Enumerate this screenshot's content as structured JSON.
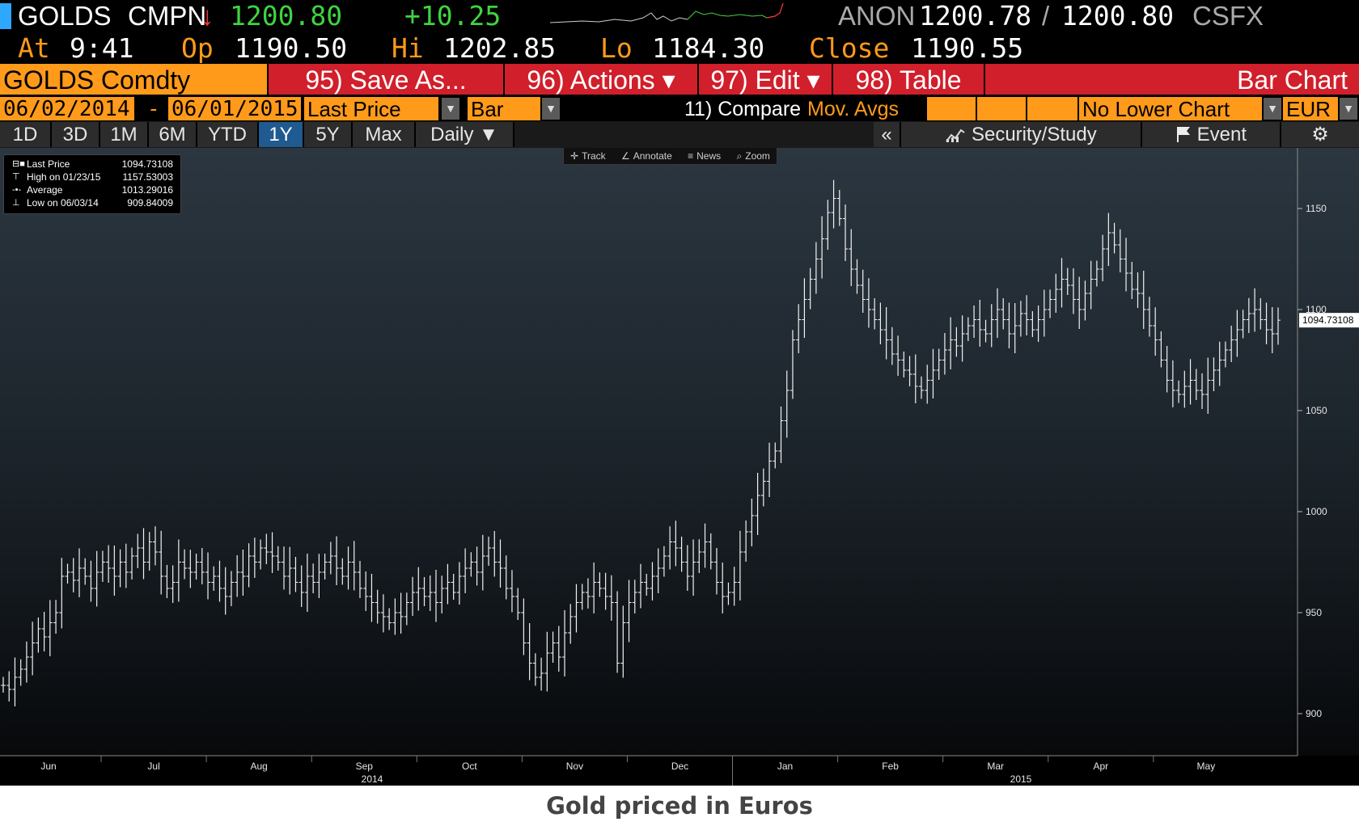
{
  "ticker": {
    "symbol": "GOLDS",
    "source": "CMPN",
    "arrow": "↓",
    "last": "1200.80",
    "change": "+10.25",
    "venue": "ANON",
    "bid": "1200.78",
    "slash": "/",
    "ask": "1200.80",
    "feed": "CSFX",
    "at_label": "At",
    "time": "9:41",
    "op_label": "Op",
    "open": "1190.50",
    "hi_label": "Hi",
    "high": "1202.85",
    "lo_label": "Lo",
    "low": "1184.30",
    "close_label": "Close",
    "close": "1190.55"
  },
  "menu": {
    "security": "GOLDS Comdty",
    "save_as": "95) Save As...",
    "actions": "96) Actions ▾",
    "edit": "97) Edit ▾",
    "table": "98) Table",
    "view": "Bar Chart"
  },
  "settings": {
    "start_date": "06/02/2014",
    "dash": "-",
    "end_date": "06/01/2015",
    "field": "Last Price",
    "style": "Bar",
    "compare": "11) Compare",
    "mov_avgs": "Mov. Avgs",
    "lower_chart": "No Lower Chart",
    "currency": "EUR",
    "dd_icon": "▼"
  },
  "ranges": [
    "1D",
    "3D",
    "1M",
    "6M",
    "YTD",
    "1Y",
    "5Y",
    "Max"
  ],
  "active_range": "1Y",
  "frequency": "Daily ▼",
  "tools": {
    "collapse": "«",
    "security_study": "Security/Study",
    "event": "Event",
    "gear": "⚙"
  },
  "chart_tools": {
    "track": "Track",
    "annotate": "Annotate",
    "news": "News",
    "zoom": "Zoom"
  },
  "legend": [
    {
      "label": "Last Price",
      "value": "1094.73108"
    },
    {
      "label": "High on 01/23/15",
      "value": "1157.53003"
    },
    {
      "label": "Average",
      "value": "1013.29016"
    },
    {
      "label": "Low on 06/03/14",
      "value": "909.84009"
    }
  ],
  "last_label": "1094.73108",
  "caption": "Gold priced in Euros",
  "colors": {
    "orange": "#ff9a1a",
    "red_bar": "#d11f2b",
    "green": "#3fd43f",
    "active_tab": "#1f5a90"
  },
  "chart_data": {
    "type": "bar",
    "field": "Last Price",
    "currency": "EUR",
    "ylim": [
      880,
      1180
    ],
    "yticks": [
      900,
      950,
      1000,
      1050,
      1100,
      1150
    ],
    "x_months": [
      "Jun",
      "Jul",
      "Aug",
      "Sep",
      "Oct",
      "Nov",
      "Dec",
      "Jan",
      "Feb",
      "Mar",
      "Apr",
      "May"
    ],
    "x_years": [
      "2014",
      "2015"
    ],
    "x_range": [
      "2014-06-02",
      "2015-06-01"
    ],
    "last_value": 1094.73108,
    "high": {
      "date": "01/23/15",
      "value": 1157.53003
    },
    "average": 1013.29016,
    "low": {
      "date": "06/03/14",
      "value": 909.84009
    },
    "closes": [
      914,
      912,
      918,
      922,
      928,
      935,
      942,
      938,
      945,
      950,
      968,
      970,
      966,
      972,
      968,
      962,
      970,
      975,
      972,
      968,
      975,
      970,
      978,
      982,
      975,
      985,
      980,
      968,
      962,
      965,
      975,
      972,
      970,
      975,
      970,
      965,
      968,
      962,
      958,
      965,
      970,
      968,
      978,
      975,
      982,
      980,
      978,
      975,
      968,
      972,
      965,
      960,
      968,
      965,
      970,
      975,
      978,
      972,
      968,
      975,
      970,
      962,
      958,
      955,
      950,
      948,
      945,
      950,
      948,
      955,
      960,
      962,
      958,
      960,
      955,
      962,
      965,
      960,
      968,
      972,
      975,
      970,
      978,
      982,
      975,
      972,
      962,
      958,
      950,
      935,
      925,
      918,
      920,
      930,
      935,
      928,
      940,
      948,
      955,
      960,
      958,
      965,
      962,
      958,
      955,
      925,
      945,
      955,
      960,
      965,
      962,
      968,
      972,
      978,
      985,
      982,
      975,
      968,
      975,
      980,
      985,
      975,
      965,
      958,
      960,
      965,
      980,
      990,
      998,
      1008,
      1015,
      1025,
      1030,
      1045,
      1060,
      1085,
      1095,
      1105,
      1115,
      1125,
      1135,
      1148,
      1155,
      1145,
      1130,
      1120,
      1112,
      1105,
      1100,
      1095,
      1090,
      1085,
      1078,
      1075,
      1070,
      1068,
      1062,
      1060,
      1065,
      1070,
      1075,
      1080,
      1085,
      1082,
      1088,
      1092,
      1095,
      1090,
      1088,
      1095,
      1100,
      1095,
      1088,
      1092,
      1098,
      1095,
      1090,
      1095,
      1100,
      1105,
      1110,
      1115,
      1112,
      1105,
      1100,
      1108,
      1115,
      1120,
      1130,
      1138,
      1132,
      1125,
      1118,
      1110,
      1108,
      1100,
      1092,
      1085,
      1075,
      1065,
      1060,
      1058,
      1062,
      1065,
      1060,
      1058,
      1065,
      1070,
      1075,
      1080,
      1085,
      1090,
      1095,
      1098,
      1100,
      1095,
      1090,
      1088,
      1094.73108
    ]
  }
}
